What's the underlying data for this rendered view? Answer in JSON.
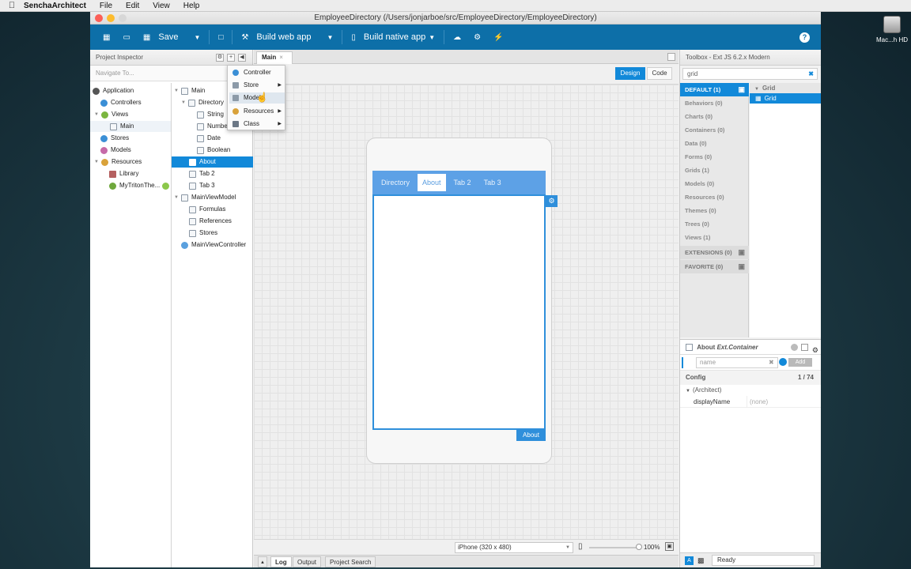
{
  "menubar": {
    "app": "SenchaArchitect",
    "items": [
      "File",
      "Edit",
      "View",
      "Help"
    ]
  },
  "desktop": {
    "hd_label": "Mac...h HD"
  },
  "window": {
    "title": "EmployeeDirectory (/Users/jonjarboe/src/EmployeeDirectory/EmployeeDirectory)"
  },
  "toolbar": {
    "save": "Save",
    "build_web": "Build web app",
    "build_native": "Build native app"
  },
  "project_inspector": {
    "title": "Project Inspector",
    "navigate_placeholder": "Navigate To...",
    "left": [
      "Application",
      "Controllers",
      "Views",
      "Main",
      "Stores",
      "Models",
      "Resources",
      "Library",
      "MyTritonThe..."
    ],
    "right": [
      "Main",
      "Directory",
      "String",
      "Number",
      "Date",
      "Boolean",
      "About",
      "Tab 2",
      "Tab 3",
      "MainViewModel",
      "Formulas",
      "References",
      "Stores",
      "MainViewController"
    ]
  },
  "popup": {
    "items": [
      "Controller",
      "Store",
      "Model",
      "Resources",
      "Class"
    ]
  },
  "center": {
    "tab": "Main",
    "design": "Design",
    "code": "Code",
    "mobile_tabs": [
      "Directory",
      "About",
      "Tab 2",
      "Tab 3"
    ],
    "component_label": "About",
    "device": "iPhone (320 x 480)",
    "zoom": "100%",
    "bottom_tabs": [
      "Log",
      "Output",
      "Project Search"
    ]
  },
  "toolbox": {
    "title": "Toolbox - Ext JS 6.2.x Modern",
    "search_value": "grid",
    "categories": [
      "DEFAULT (1)",
      "Behaviors (0)",
      "Charts (0)",
      "Containers (0)",
      "Data (0)",
      "Forms (0)",
      "Grids (1)",
      "Models (0)",
      "Resources (0)",
      "Themes (0)",
      "Trees (0)",
      "Views (1)",
      "EXTENSIONS (0)",
      "FAVORITE (0)"
    ],
    "group": "Grid",
    "item": "Grid"
  },
  "config": {
    "component": "About",
    "type": "Ext.Container",
    "filter_placeholder": "name",
    "add": "Add",
    "section": "Config",
    "count": "1 / 74",
    "group": "(Architect)",
    "prop": "displayName",
    "prop_value": "(none)"
  },
  "status": {
    "text": "Ready"
  }
}
